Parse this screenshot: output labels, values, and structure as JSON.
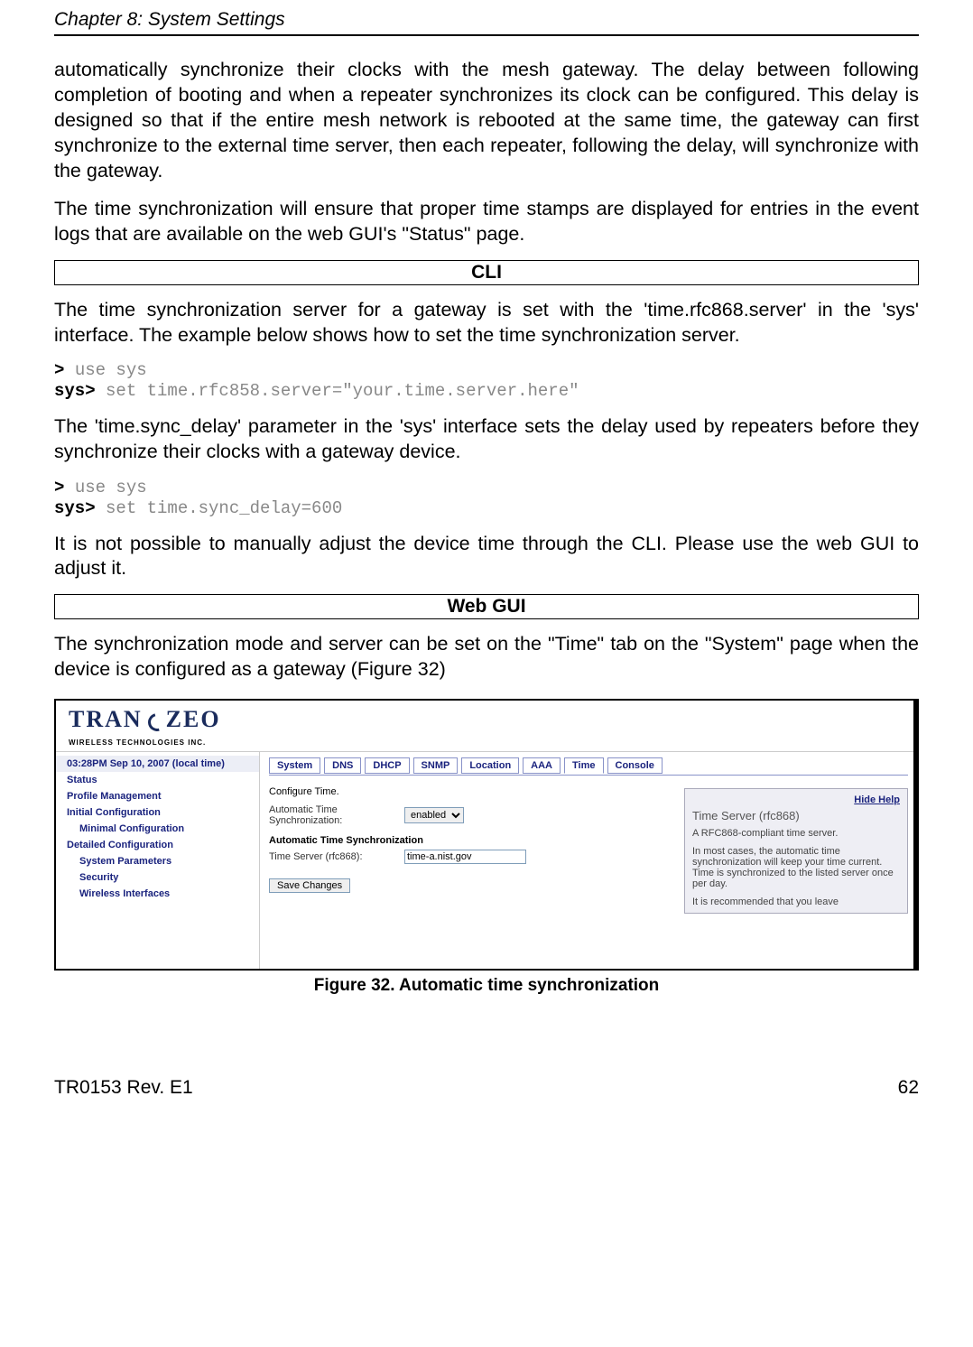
{
  "header": {
    "chapter": "Chapter 8: System Settings"
  },
  "paragraphs": {
    "p1": "automatically synchronize their clocks with the mesh gateway. The delay between following completion of booting and when a repeater synchronizes its clock can be configured. This delay is designed so that if the entire mesh network is rebooted at the same time, the gateway can first synchronize to the external time server, then each repeater, following the delay, will synchronize with the gateway.",
    "p2": "The time synchronization will ensure that proper time stamps are displayed for entries in the event logs that are available on the web GUI's \"Status\" page.",
    "cli_heading": "CLI",
    "p3": "The time synchronization server for a gateway is set with the 'time.rfc868.server' in the 'sys' interface. The example below shows how to set the time synchronization server.",
    "p4": "The 'time.sync_delay' parameter in the 'sys' interface sets the delay used by repeaters before they synchronize their clocks with a gateway device.",
    "p5": "It is not possible to manually adjust the device time through the CLI. Please use the web GUI to adjust it.",
    "web_heading": "Web GUI",
    "p6": "The synchronization mode and server can be set on the \"Time\" tab on the \"System\" page when the device is configured as a gateway (Figure 32)"
  },
  "cli": {
    "prompt1": ">",
    "cmd1": "use sys",
    "prompt2": "sys>",
    "cmd2": "set time.rfc858.server=\"your.time.server.here\"",
    "prompt3": ">",
    "cmd3": "use sys",
    "prompt4": "sys>",
    "cmd4": "set time.sync_delay=600"
  },
  "gui": {
    "logo": {
      "main": "TRAN",
      "z": "Z",
      "rest": "EO",
      "sub": "WIRELESS  TECHNOLOGIES INC."
    },
    "sidebar": {
      "time": "03:28PM Sep 10, 2007 (local time)",
      "items": [
        "Status",
        "Profile Management",
        "Initial Configuration",
        "Minimal Configuration",
        "Detailed Configuration",
        "System Parameters",
        "Security",
        "Wireless Interfaces"
      ]
    },
    "tabs": [
      "System",
      "DNS",
      "DHCP",
      "SNMP",
      "Location",
      "AAA",
      "Time",
      "Console"
    ],
    "active_tab": "Time",
    "configure_label": "Configure Time.",
    "auto_sync_label": "Automatic Time Synchronization:",
    "auto_sync_value": "enabled",
    "section_heading": "Automatic Time Synchronization",
    "server_label": "Time Server (rfc868):",
    "server_value": "time-a.nist.gov",
    "save_label": "Save Changes",
    "help": {
      "hide": "Hide Help",
      "title": "Time Server (rfc868)",
      "line1": "A RFC868-compliant time server.",
      "line2": "In most cases, the automatic time synchronization will keep your time current. Time is synchronized to the listed server once per day.",
      "line3": "It is recommended that you leave"
    }
  },
  "caption": "Figure 32. Automatic time synchronization",
  "footer": {
    "left": "TR0153 Rev. E1",
    "right": "62"
  }
}
